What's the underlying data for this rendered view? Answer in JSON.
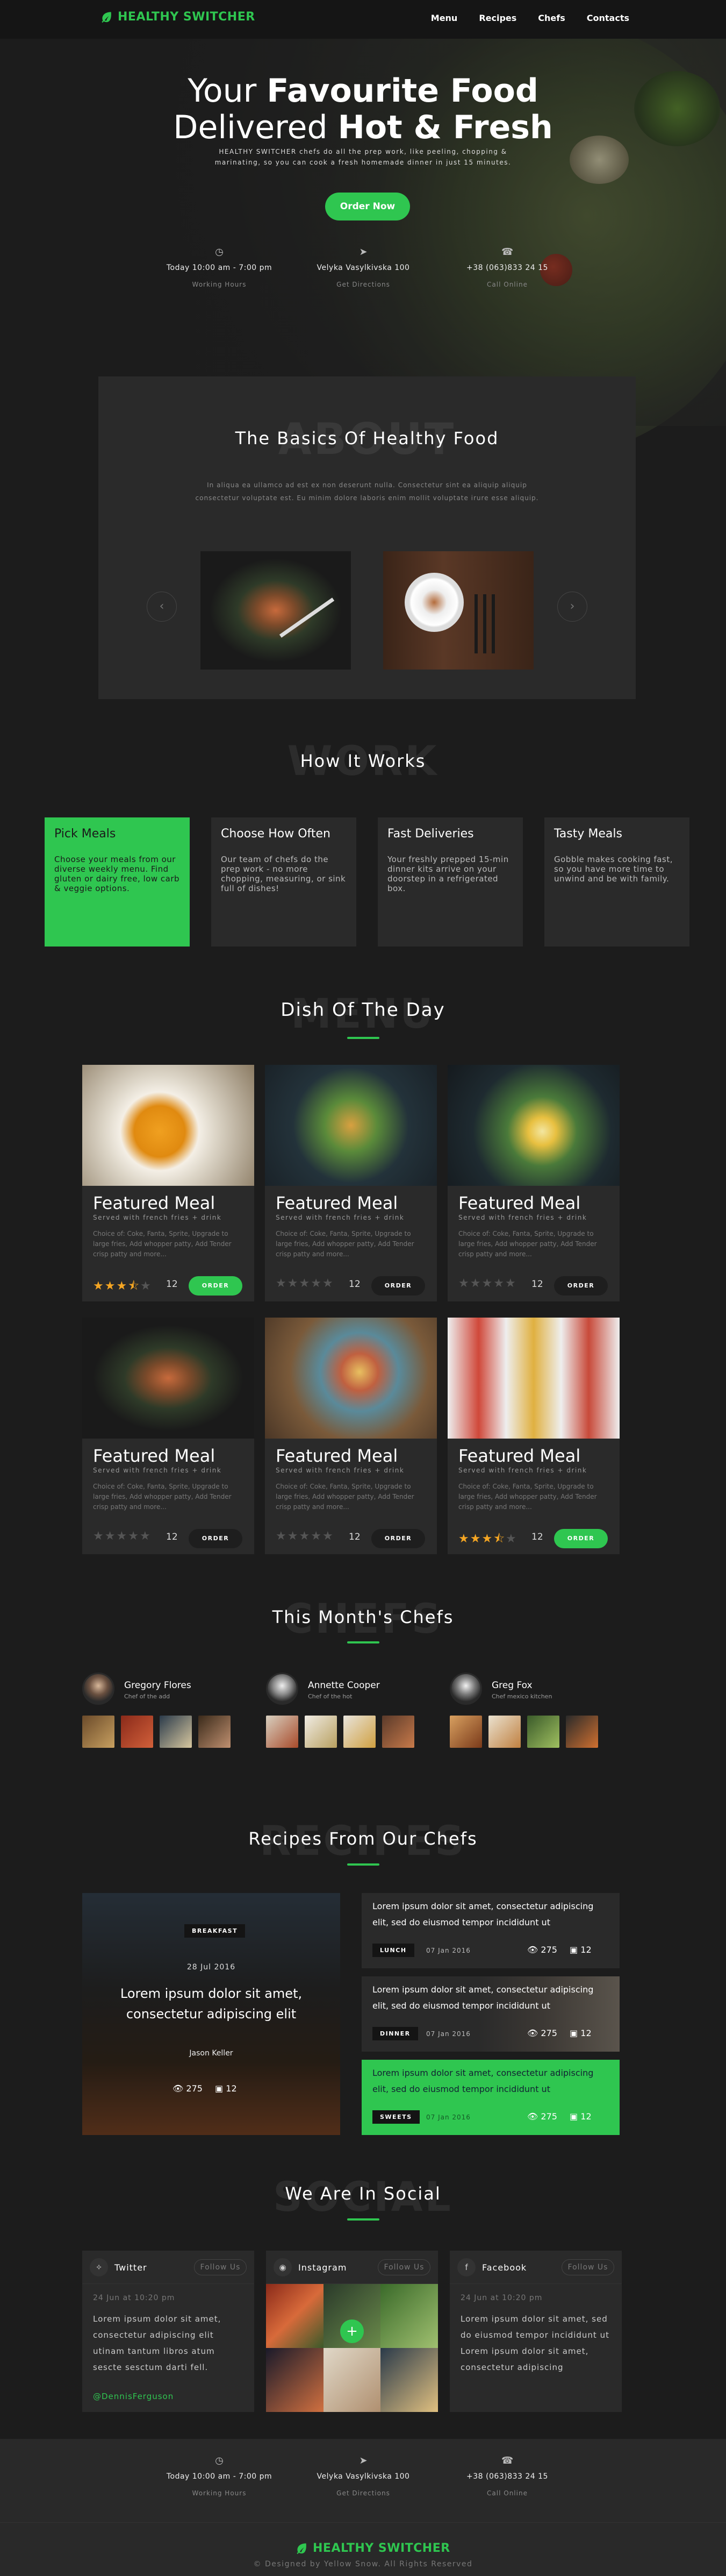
{
  "brand": {
    "name": "HEALTHY SWITCHER",
    "accent": "#2fc650"
  },
  "nav": {
    "items": [
      "Menu",
      "Recipes",
      "Chefs",
      "Contacts"
    ]
  },
  "hero": {
    "line1_plain": "Your ",
    "line1_bold": "Favourite Food",
    "line2_plain": "Delivered ",
    "line2_bold": "Hot & Fresh",
    "lead": "HEALTHY SWITCHER chefs do all the prep work, like peeling, chopping & marinating, so you can cook a fresh homemade dinner in just 15 minutes.",
    "cta": "Order Now"
  },
  "info": [
    {
      "icon": "clock-icon",
      "title": "Today 10:00 am - 7:00 pm",
      "sub": "Working Hours"
    },
    {
      "icon": "navigation-icon",
      "title": "Velyka Vasylkivska 100",
      "sub": "Get Directions"
    },
    {
      "icon": "phone-icon",
      "title": "+38 (063)833 24 15",
      "sub": "Call Online"
    }
  ],
  "basics": {
    "ghost": "ABOUT",
    "title": "The Basics Of Healthy Food",
    "text": "In aliqua ea ullamco ad est ex non deserunt nulla. Consectetur sint ea aliquip aliquip consectetur voluptate est. Eu minim dolore laboris enim mollit voluptate irure esse aliquip."
  },
  "how": {
    "ghost": "WORK",
    "title": "How It Works",
    "steps": [
      {
        "title": "Pick Meals",
        "text": "Choose your meals from our diverse weekly menu. Find gluten or dairy free, low carb & veggie options."
      },
      {
        "title": "Choose How Often",
        "text": "Our team of chefs do the prep work - no more chopping, measuring, or sink full of dishes!"
      },
      {
        "title": "Fast Deliveries",
        "text": "Your freshly prepped 15-min dinner kits arrive on your doorstep in a refrigerated box."
      },
      {
        "title": "Tasty Meals",
        "text": "Gobble makes cooking fast, so you have more time to unwind and be with family."
      }
    ]
  },
  "dish": {
    "ghost": "MENU",
    "title": "Dish Of The Day",
    "meals": [
      {
        "title": "Featured Meal",
        "sub": "Served with french fries + drink",
        "desc": "Choice of: Coke, Fanta, Sprite, Upgrade to large fries, Add whopper patty, Add Tender crisp patty and more...",
        "count": "12",
        "order": "ORDER",
        "rating": 3.5
      },
      {
        "title": "Featured Meal",
        "sub": "Served with french fries + drink",
        "desc": "Choice of: Coke, Fanta, Sprite, Upgrade to large fries, Add whopper patty, Add Tender crisp patty and more...",
        "count": "12",
        "order": "ORDER",
        "rating": 0
      },
      {
        "title": "Featured Meal",
        "sub": "Served with french fries + drink",
        "desc": "Choice of: Coke, Fanta, Sprite, Upgrade to large fries, Add whopper patty, Add Tender crisp patty and more...",
        "count": "12",
        "order": "ORDER",
        "rating": 0
      },
      {
        "title": "Featured Meal",
        "sub": "Served with french fries + drink",
        "desc": "Choice of: Coke, Fanta, Sprite, Upgrade to large fries, Add whopper patty, Add Tender crisp patty and more...",
        "count": "12",
        "order": "ORDER",
        "rating": 0
      },
      {
        "title": "Featured Meal",
        "sub": "Served with french fries + drink",
        "desc": "Choice of: Coke, Fanta, Sprite, Upgrade to large fries, Add whopper patty, Add Tender crisp patty and more...",
        "count": "12",
        "order": "ORDER",
        "rating": 0
      },
      {
        "title": "Featured Meal",
        "sub": "Served with french fries + drink",
        "desc": "Choice of: Coke, Fanta, Sprite, Upgrade to large fries, Add whopper patty, Add Tender crisp patty and more...",
        "count": "12",
        "order": "ORDER",
        "rating": 3.5
      }
    ]
  },
  "chefs": {
    "ghost": "CHEFS",
    "title": "This Month's Chefs",
    "list": [
      {
        "name": "Gregory Flores",
        "role": "Chef of the add"
      },
      {
        "name": "Annette Cooper",
        "role": "Chef of the hot"
      },
      {
        "name": "Greg Fox",
        "role": "Chef mexico kitchen"
      }
    ]
  },
  "recipes": {
    "ghost": "RECIPES",
    "title": "Recipes From Our Chefs",
    "main": {
      "tag": "BREAKFAST",
      "date": "28 Jul 2016",
      "title": "Lorem ipsum dolor sit amet, consectetur adipiscing elit",
      "author": "Jason Keller",
      "views": "275",
      "comments": "12"
    },
    "items": [
      {
        "title": "Lorem ipsum dolor sit amet, consectetur adipiscing elit, sed do eiusmod tempor incididunt ut",
        "tag": "LUNCH",
        "date": "07 Jan 2016",
        "views": "275",
        "comments": "12"
      },
      {
        "title": "Lorem ipsum dolor sit amet, consectetur adipiscing elit, sed do eiusmod tempor incididunt ut",
        "tag": "DINNER",
        "date": "07 Jan 2016",
        "views": "275",
        "comments": "12"
      },
      {
        "title": "Lorem ipsum dolor sit amet, consectetur adipiscing elit, sed do eiusmod tempor incididunt ut",
        "tag": "SWEETS",
        "date": "07 Jan 2016",
        "views": "275",
        "comments": "12"
      }
    ]
  },
  "social": {
    "ghost": "SOCIAL",
    "title": "We Are In Social",
    "cards": [
      {
        "name": "Twitter",
        "follow": "Follow Us",
        "date": "24 Jun at 10:20 pm",
        "text": "Lorem ipsum dolor sit amet, consectetur adipiscing elit utinam tantum libros atum sescte sesctum darti fell.",
        "handle": "@DennisFerguson"
      },
      {
        "name": "Instagram",
        "follow": "Follow Us"
      },
      {
        "name": "Facebook",
        "follow": "Follow Us",
        "date": "24 Jun at 10:20 pm",
        "text": "Lorem ipsum dolor sit amet, sed do eiusmod tempor incididunt ut Lorem ipsum dolor sit amet, consectetur adipiscing"
      }
    ]
  },
  "footer": {
    "copyright": "© Designed by Yellow Snow. All Rights Reserved"
  }
}
